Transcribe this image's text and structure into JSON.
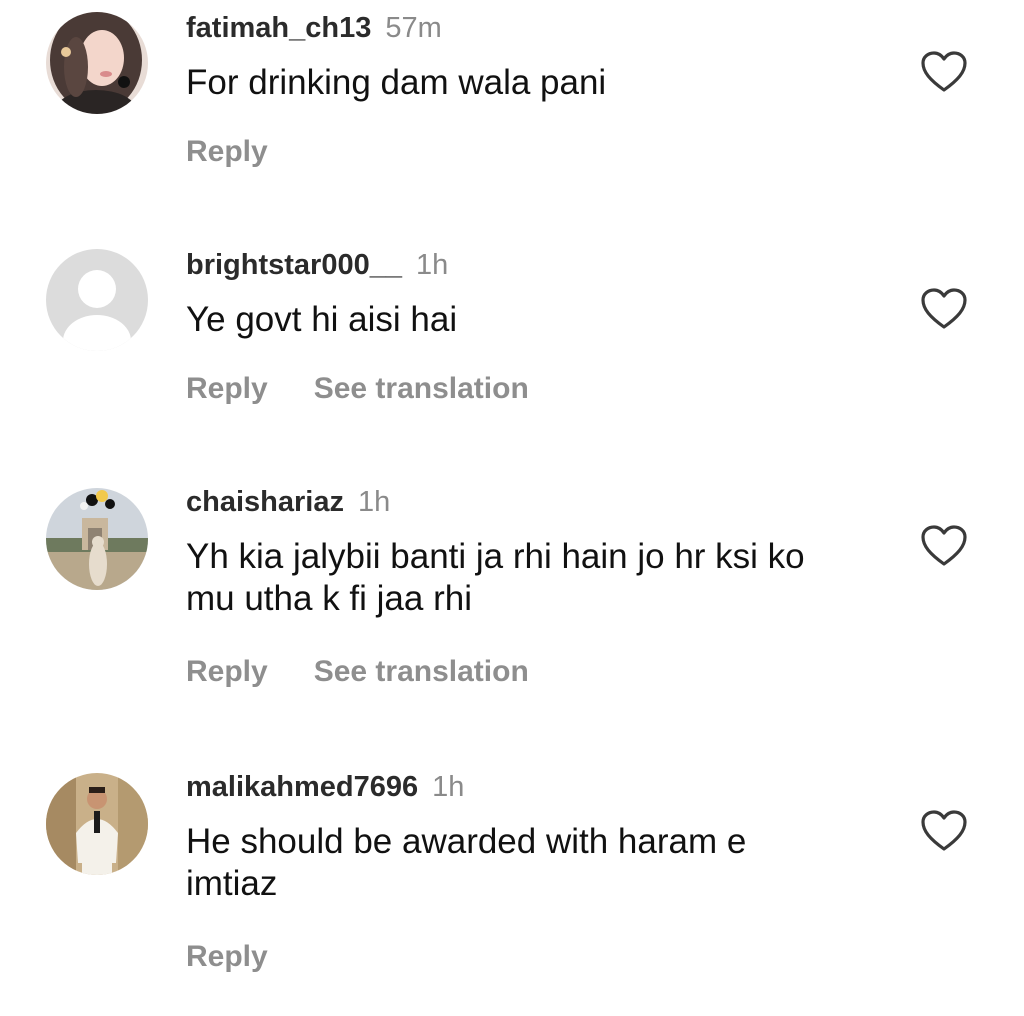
{
  "comments": [
    {
      "username": "fatimah_ch13",
      "time": "57m",
      "text": "For drinking dam wala pani",
      "reply_label": "Reply",
      "translate_label": ""
    },
    {
      "username": "brightstar000__",
      "time": "1h",
      "text": "Ye govt hi aisi hai",
      "reply_label": "Reply",
      "translate_label": "See translation"
    },
    {
      "username": "chaishariaz",
      "time": "1h",
      "text": "Yh kia jalybii banti ja rhi hain jo hr ksi ko mu utha k fi jaa rhi",
      "reply_label": "Reply",
      "translate_label": "See translation"
    },
    {
      "username": "malikahmed7696",
      "time": "1h",
      "text": "He should be awarded with haram e imtiaz",
      "reply_label": "Reply",
      "translate_label": ""
    }
  ],
  "icons": {
    "like": "heart-outline-icon",
    "default_avatar": "person-silhouette-icon"
  },
  "colors": {
    "username": "#2b2b2b",
    "timestamp": "#8a8a8a",
    "action_text": "#8e8e8e",
    "heart_stroke": "#3a3a3a",
    "default_avatar_bg": "#dcdcdc"
  }
}
